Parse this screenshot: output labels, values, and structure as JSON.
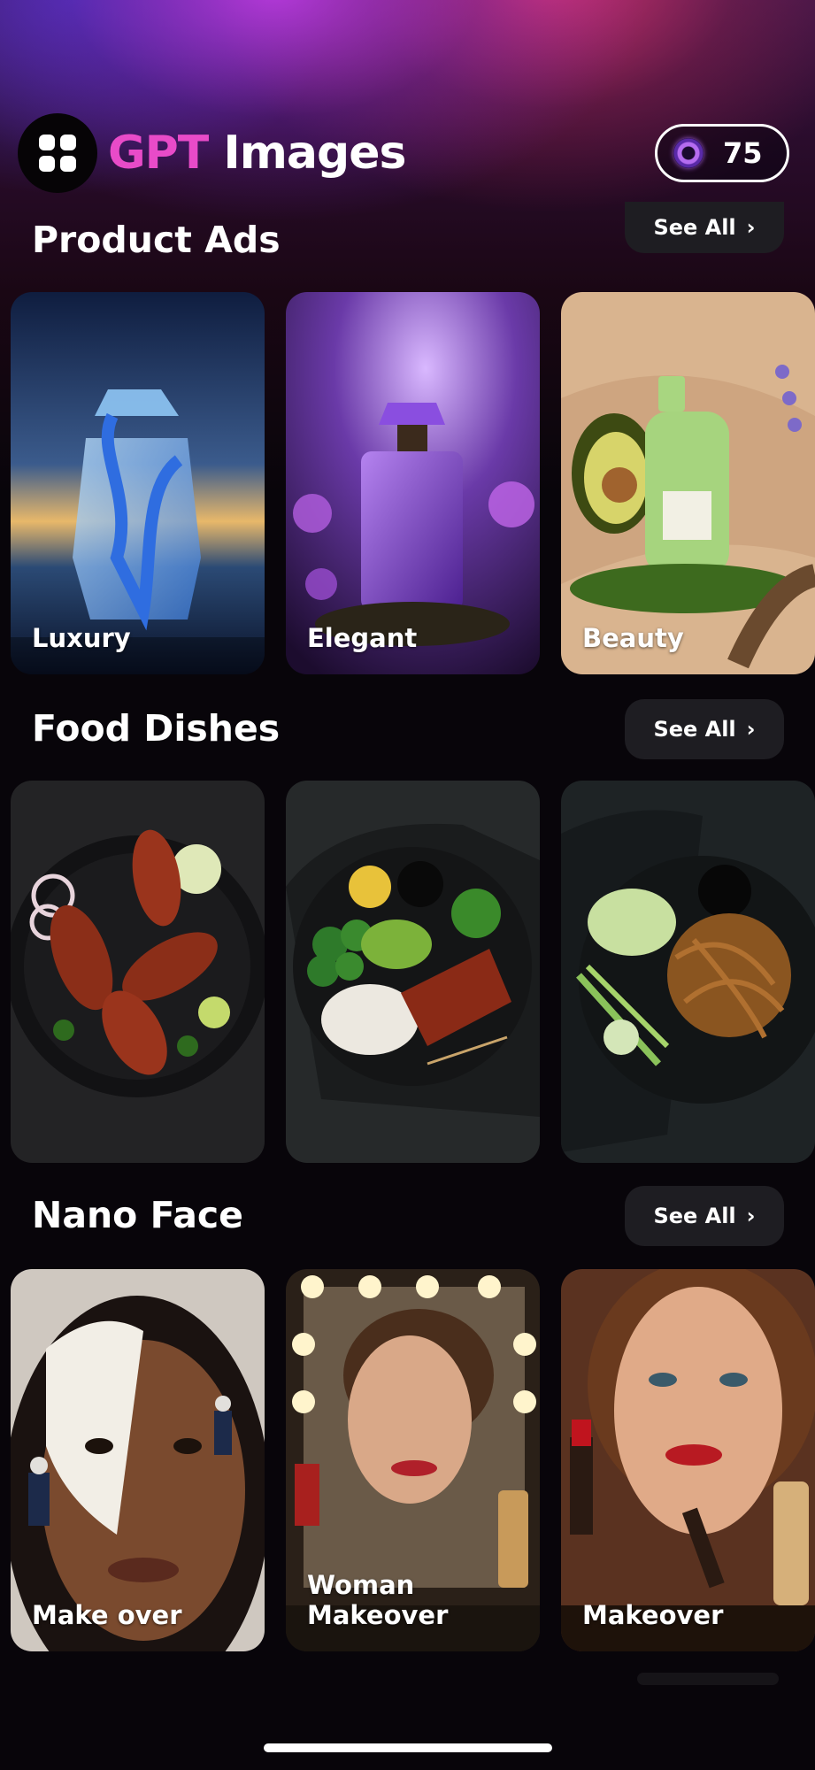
{
  "header": {
    "brand_part1": "GPT",
    "brand_part2": "Images",
    "credits": "75",
    "menu_icon": "grid-icon",
    "credit_icon": "gem-icon"
  },
  "sections": [
    {
      "title": "Product Ads",
      "see_all": "See All",
      "cards": [
        {
          "label": "Luxury",
          "image": "blue crystal perfume bottle with ribbon at sunset"
        },
        {
          "label": "Elegant",
          "image": "purple perfume bottle among violet flowers"
        },
        {
          "label": "Beauty",
          "image": "green serum bottle with avocado and lavender"
        }
      ]
    },
    {
      "title": "Food Dishes",
      "see_all": "See All",
      "cards": [
        {
          "label": "",
          "image": "tandoori chicken on dark plate"
        },
        {
          "label": "",
          "image": "glazed salmon bowl with rice and greens"
        },
        {
          "label": "",
          "image": "noodles stir fry on dark plate"
        }
      ]
    },
    {
      "title": "Nano Face",
      "see_all": "See All",
      "cards": [
        {
          "label": "Make over",
          "image": "face with mask and tiny workers"
        },
        {
          "label": "Woman Makeover",
          "image": "woman at vanity mirror with tiny workers"
        },
        {
          "label": "Makeover",
          "image": "woman with lipstick and tiny workers"
        }
      ]
    }
  ],
  "colors": {
    "brand_accent": "#e84bc8",
    "background": "#08050a",
    "button_bg": "#1e1d22"
  }
}
